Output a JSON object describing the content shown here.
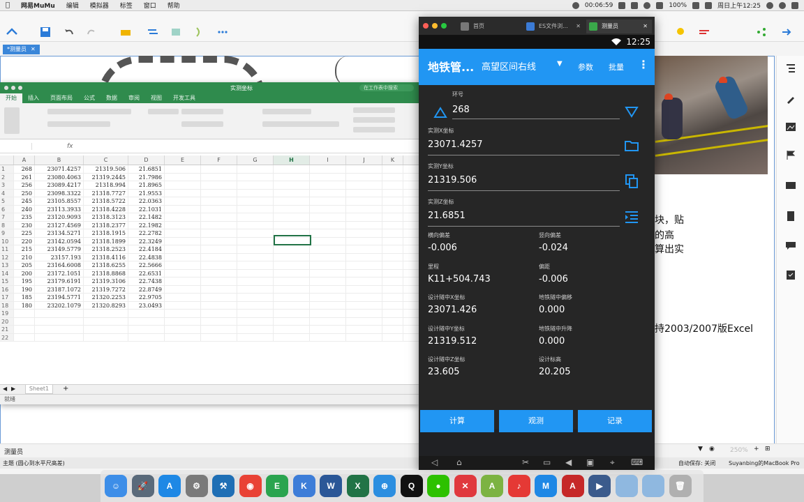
{
  "menubar": {
    "app_name": "网易MuMu",
    "items": [
      "编辑",
      "模拟器",
      "标签",
      "窗口",
      "帮助"
    ],
    "clock_extra": "00:06:59",
    "battery": "100%",
    "datetime": "周日上午12:25"
  },
  "bg_app": {
    "doc_tab": "*测量员",
    "note_lines": [
      "块，贴",
      "的高",
      "算出实",
      "持2003/2007版Excel"
    ],
    "status_left": "测量员",
    "status_bottom_left": "主题 (圆心到水平尺高差)",
    "zoom": "250%",
    "autosave": "自动保存: 关闭",
    "owner": "Suyanbing的MacBook Pro"
  },
  "excel": {
    "title": "实测坐标",
    "search_placeholder": "在工作表中搜索",
    "tabs": [
      "开始",
      "插入",
      "页面布局",
      "公式",
      "数据",
      "审阅",
      "视图",
      "开发工具"
    ],
    "col_headers": [
      "A",
      "B",
      "C",
      "D",
      "E",
      "F",
      "G",
      "H",
      "I",
      "J",
      "K"
    ],
    "selected_col": "H",
    "rows": [
      [
        "1",
        "268",
        "23071.4257",
        "21319.506",
        "21.6851"
      ],
      [
        "2",
        "261",
        "23080.4063",
        "21319.2445",
        "21.7986"
      ],
      [
        "3",
        "256",
        "23089.4217",
        "21318.994",
        "21.8965"
      ],
      [
        "4",
        "250",
        "23098.3322",
        "21318.7727",
        "21.9553"
      ],
      [
        "5",
        "245",
        "23105.8557",
        "21318.5722",
        "22.0363"
      ],
      [
        "6",
        "240",
        "23113.3933",
        "21318.4228",
        "22.1031"
      ],
      [
        "7",
        "235",
        "23120.9093",
        "21318.3123",
        "22.1482"
      ],
      [
        "8",
        "230",
        "23127.4569",
        "21318.2377",
        "22.1982"
      ],
      [
        "9",
        "225",
        "23134.5271",
        "21318.1915",
        "22.2782"
      ],
      [
        "10",
        "220",
        "23142.0594",
        "21318.1899",
        "22.3249"
      ],
      [
        "11",
        "215",
        "23149.5779",
        "21318.2523",
        "22.4184"
      ],
      [
        "12",
        "210",
        "23157.193",
        "21318.4116",
        "22.4838"
      ],
      [
        "13",
        "205",
        "23164.6008",
        "21318.6255",
        "22.5666"
      ],
      [
        "14",
        "200",
        "23172.1051",
        "21318.8868",
        "22.6531"
      ],
      [
        "15",
        "195",
        "23179.6191",
        "21319.3106",
        "22.7438"
      ],
      [
        "16",
        "190",
        "23187.1072",
        "21319.7272",
        "22.8749"
      ],
      [
        "17",
        "185",
        "23194.5771",
        "21320.2253",
        "22.9705"
      ],
      [
        "18",
        "180",
        "23202.1079",
        "21320.8293",
        "23.0493"
      ],
      [
        "19",
        "",
        "",
        "",
        ""
      ],
      [
        "20",
        "",
        "",
        "",
        ""
      ],
      [
        "21",
        "",
        "",
        "",
        ""
      ],
      [
        "22",
        "",
        "",
        "",
        ""
      ]
    ],
    "sheet_name": "Sheet1",
    "status": "就绪"
  },
  "emulator": {
    "tabs": [
      {
        "label": "首页"
      },
      {
        "label": "ES文件浏..."
      },
      {
        "label": "测量员"
      }
    ],
    "time": "12:25",
    "app_title": "地铁管...",
    "section": "高望区间右线",
    "action_params": "参数",
    "action_batch": "批量",
    "ring_label": "环号",
    "ring_value": "268",
    "x_label": "实测X坐标",
    "x_value": "23071.4257",
    "y_label": "实测Y坐标",
    "y_value": "21319.506",
    "z_label": "实测Z坐标",
    "z_value": "21.6851",
    "results": [
      {
        "label": "横向偏差",
        "value": "-0.006"
      },
      {
        "label": "竖向偏差",
        "value": "-0.024"
      },
      {
        "label": "里程",
        "value": "K11+504.743"
      },
      {
        "label": "偏距",
        "value": "-0.006"
      },
      {
        "label": "设计隧中X坐标",
        "value": "23071.426"
      },
      {
        "label": "地铁隧中偏移",
        "value": "0.000"
      },
      {
        "label": "设计隧中Y坐标",
        "value": "21319.512"
      },
      {
        "label": "地铁隧中升降",
        "value": "0.000"
      },
      {
        "label": "设计隧中Z坐标",
        "value": "23.605"
      },
      {
        "label": "设计标高",
        "value": "20.205"
      }
    ],
    "btn_calc": "计算",
    "btn_observe": "观测",
    "btn_record": "记录"
  },
  "dock": {
    "icons": [
      "finder-icon",
      "launchpad-icon",
      "app-store-icon",
      "system-preferences-icon",
      "xcode-icon",
      "chrome-icon",
      "evernote-icon",
      "keynote-icon",
      "word-icon",
      "excel-icon",
      "baidu-netdisk-icon",
      "qq-icon",
      "wechat-icon",
      "xmind-icon",
      "android-emulator-icon",
      "netease-music-icon",
      "mumu-icon",
      "autocad-icon",
      "quicktime-icon",
      "desktop-folder-icon",
      "documents-folder-icon",
      "trash-icon"
    ]
  }
}
